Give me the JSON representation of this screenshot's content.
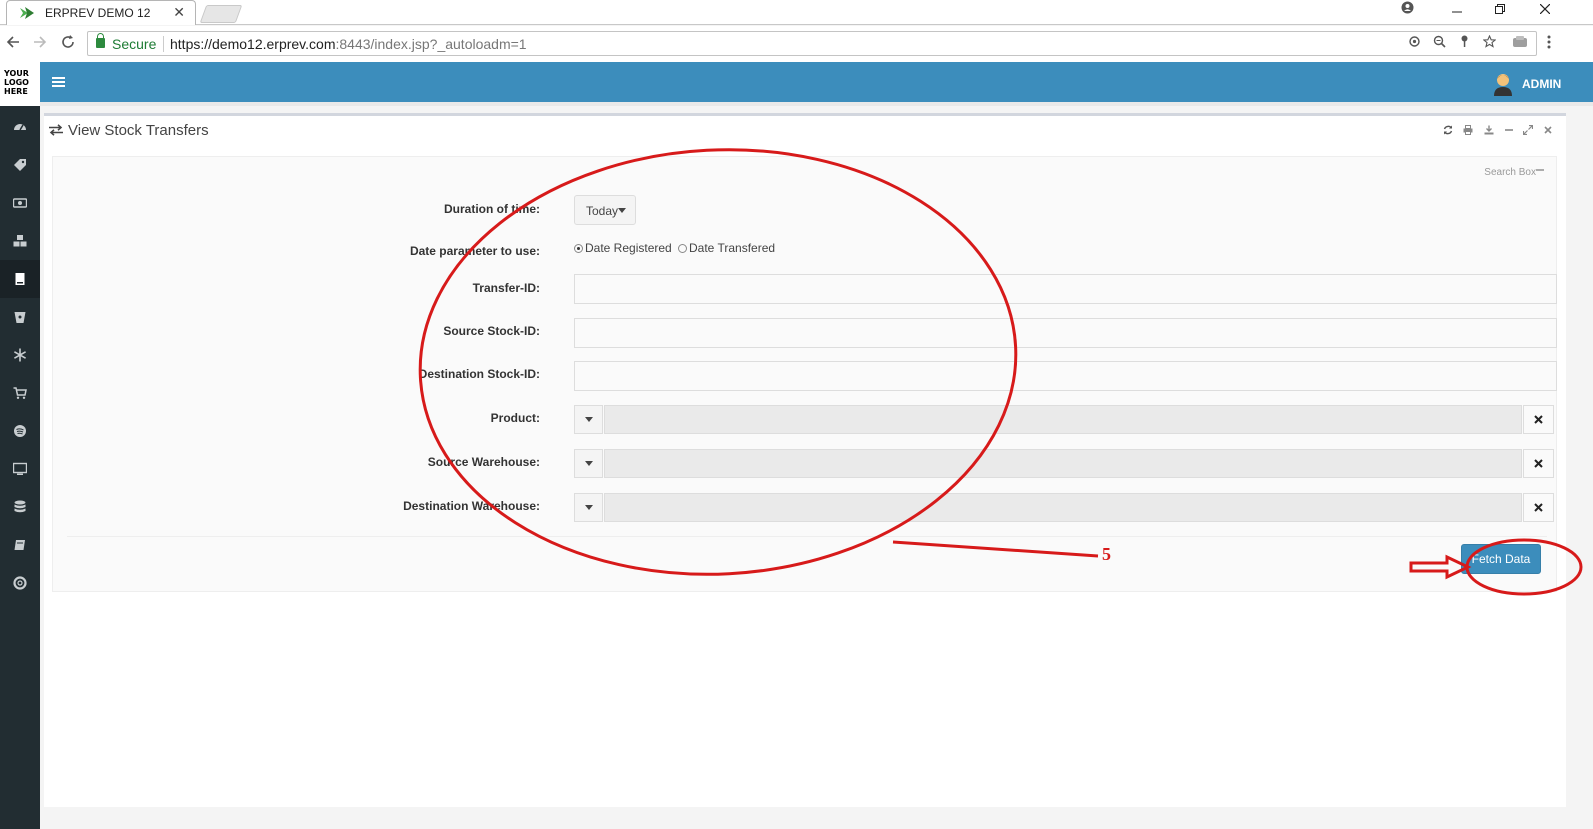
{
  "browser": {
    "tab_title": "ERPREV DEMO 12",
    "tab_close": "✕",
    "secure_label": "Secure",
    "url_host": "https://demo12.erprev.com",
    "url_rest": ":8443/index.jsp?_autoloadm=1",
    "colors": {
      "secure": "#1e7c34",
      "favicon": "#4caf50"
    }
  },
  "app": {
    "logo_lines": [
      "YOUR",
      "LOGO",
      "HERE"
    ],
    "user_label": "ADMIN",
    "brand_color": "#3c8dbc",
    "sidebar_color": "#222d32",
    "sidebar_icons": [
      "dashboard-icon",
      "tag-icon",
      "money-icon",
      "cubes-icon",
      "book-icon",
      "bitbucket-icon",
      "snowflake-icon",
      "cart-icon",
      "spotify-icon",
      "desktop-icon",
      "database-icon",
      "book-open-icon",
      "support-icon"
    ]
  },
  "page": {
    "title": "View Stock Transfers",
    "search_box_label": "Search Box",
    "tools": [
      "refresh-icon",
      "print-icon",
      "download-icon",
      "minimize-icon",
      "expand-icon",
      "close-icon"
    ]
  },
  "form": {
    "duration_label": "Duration of time:",
    "duration_value": "Today",
    "date_param_label": "Date parameter to use:",
    "radio_registered": "Date Registered",
    "radio_transfered": "Date Transfered",
    "radio_selected": "Date Registered",
    "transfer_id_label": "Transfer-ID:",
    "transfer_id_value": "",
    "source_stock_label": "Source Stock-ID:",
    "source_stock_value": "",
    "dest_stock_label": "Destination Stock-ID:",
    "dest_stock_value": "",
    "product_label": "Product:",
    "source_wh_label": "Source Warehouse:",
    "dest_wh_label": "Destination Warehouse:",
    "fetch_label": "Fetch Data"
  },
  "annotation": {
    "number": "5",
    "color": "#d71a1a"
  }
}
